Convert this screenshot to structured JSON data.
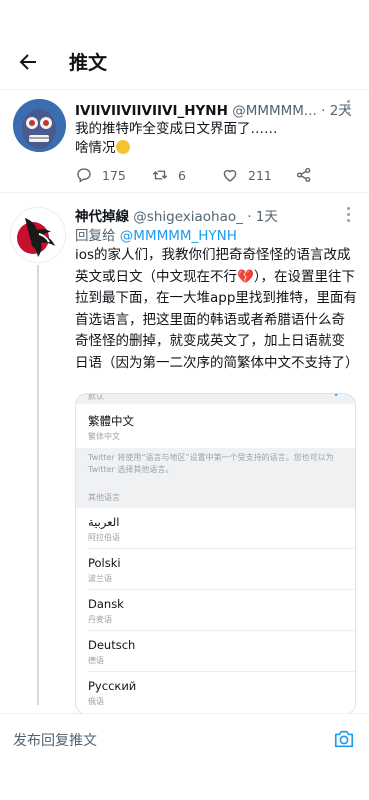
{
  "header": {
    "title": "推文"
  },
  "tweet1": {
    "name": "IVIIVIIVIIVIIVI_HYNH",
    "handle": "@MMMMM...",
    "time": "· 2天",
    "text_line1": "我的推特咋全变成日文界面了……",
    "text_line2": "啥情况",
    "emoji": "😐",
    "actions": {
      "replies": "175",
      "retweets": "6",
      "likes": "211"
    },
    "icons": [
      "comment-icon",
      "retweet-icon",
      "heart-icon",
      "share-icon"
    ]
  },
  "tweet2": {
    "name": "神代掉線",
    "handle": "@shigexiaohao_",
    "time": "· 1天",
    "reply_prefix": "回复给",
    "reply_handle": "@MMMMM_HYNH",
    "text_part1": "ios的家人们，我教你们把奇奇怪怪的语言改成英文或日文（中文现在不行",
    "broken_heart": "💔",
    "text_part2": "），在设置里往下拉到最下面，在一大堆app里找到推特，里面有首选语言，把这里面的韩语或者希腊语什么奇奇怪怪的删掉，就变成英文了，加上日语就变日语（因为第一二次序的简繁体中文不支持了）",
    "screenshot": {
      "top_label": "默认",
      "check": "✓",
      "selected_main": "繁體中文",
      "selected_sub": "繁体中文",
      "note": "Twitter 将使用“语言与地区”设置中第一个受支持的语言。您也可以为 Twitter 选择其他语言。",
      "section": "其他语言",
      "languages": [
        {
          "main": "العربية",
          "sub": "阿拉伯语"
        },
        {
          "main": "Polski",
          "sub": "波兰语"
        },
        {
          "main": "Dansk",
          "sub": "丹麦语"
        },
        {
          "main": "Deutsch",
          "sub": "德语"
        },
        {
          "main": "Русский",
          "sub": "俄语"
        }
      ]
    }
  },
  "reply_bar": {
    "placeholder": "发布回复推文"
  },
  "colors": {
    "accent": "#1d9bf0",
    "text": "#0f1419",
    "muted": "#536471",
    "border": "#eef1f3"
  }
}
